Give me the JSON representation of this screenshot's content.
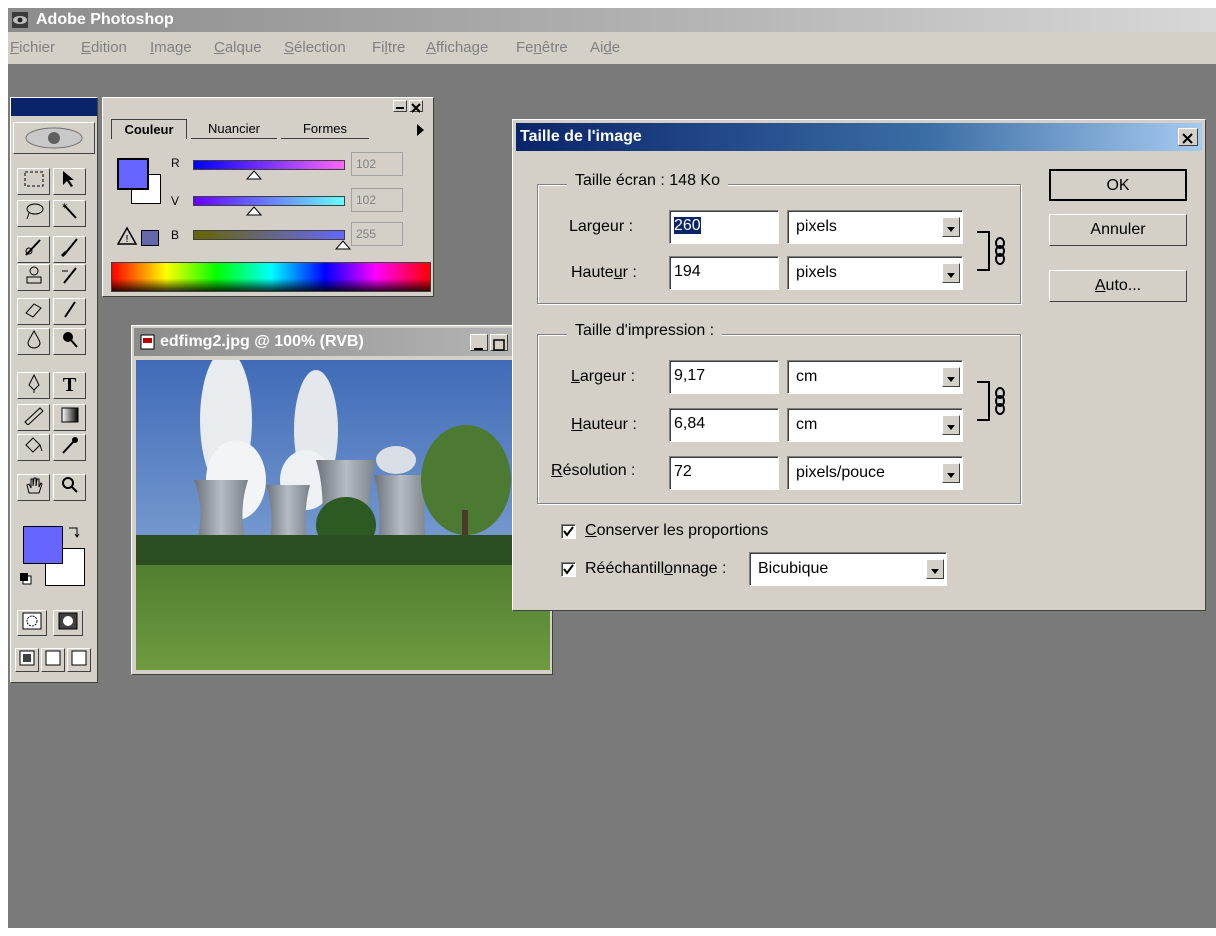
{
  "app": {
    "title": "Adobe Photoshop",
    "menu": [
      {
        "pre": "",
        "u": "F",
        "post": "ichier"
      },
      {
        "pre": "",
        "u": "E",
        "post": "dition"
      },
      {
        "pre": "",
        "u": "I",
        "post": "mage"
      },
      {
        "pre": "",
        "u": "C",
        "post": "alque"
      },
      {
        "pre": "",
        "u": "S",
        "post": "élection"
      },
      {
        "pre": "Fi",
        "u": "l",
        "post": "tre"
      },
      {
        "pre": "",
        "u": "A",
        "post": "ffichage"
      },
      {
        "pre": "Fe",
        "u": "n",
        "post": "être"
      },
      {
        "pre": "Ai",
        "u": "d",
        "post": "e"
      }
    ]
  },
  "color_palette": {
    "tabs": [
      "Couleur",
      "Nuancier",
      "Formes"
    ],
    "active_tab": "Couleur",
    "sliders": [
      {
        "label": "R",
        "value": "102"
      },
      {
        "label": "V",
        "value": "102"
      },
      {
        "label": "B",
        "value": "255"
      }
    ],
    "foreground_color": "#6666ff",
    "background_color": "#ffffff"
  },
  "image_window": {
    "title": "edfimg2.jpg @ 100% (RVB)"
  },
  "dialog": {
    "title": "Taille de l'image",
    "screen_group": {
      "title": "Taille écran : 148 Ko",
      "width_label_pre": "Lar",
      "width_label_u": "g",
      "width_label_post": "eur :",
      "width_value": "260",
      "width_unit": "pixels",
      "height_label_pre": "Haute",
      "height_label_u": "u",
      "height_label_post": "r :",
      "height_value": "194",
      "height_unit": "pixels"
    },
    "print_group": {
      "title": "Taille d'impression :",
      "width_label_pre": "",
      "width_label_u": "L",
      "width_label_post": "argeur :",
      "width_value": "9,17",
      "width_unit": "cm",
      "height_label_pre": "",
      "height_label_u": "H",
      "height_label_post": "auteur :",
      "height_value": "6,84",
      "height_unit": "cm",
      "res_label_pre": "",
      "res_label_u": "R",
      "res_label_post": "ésolution :",
      "res_value": "72",
      "res_unit": "pixels/pouce"
    },
    "constrain": {
      "pre": "",
      "u": "C",
      "post": "onserver les proportions",
      "checked": true
    },
    "resample": {
      "pre": "Rééchantill",
      "u": "o",
      "post": "nnage :",
      "checked": true,
      "method": "Bicubique"
    },
    "buttons": {
      "ok": "OK",
      "cancel": "Annuler",
      "auto_u": "A",
      "auto_post": "uto..."
    }
  }
}
